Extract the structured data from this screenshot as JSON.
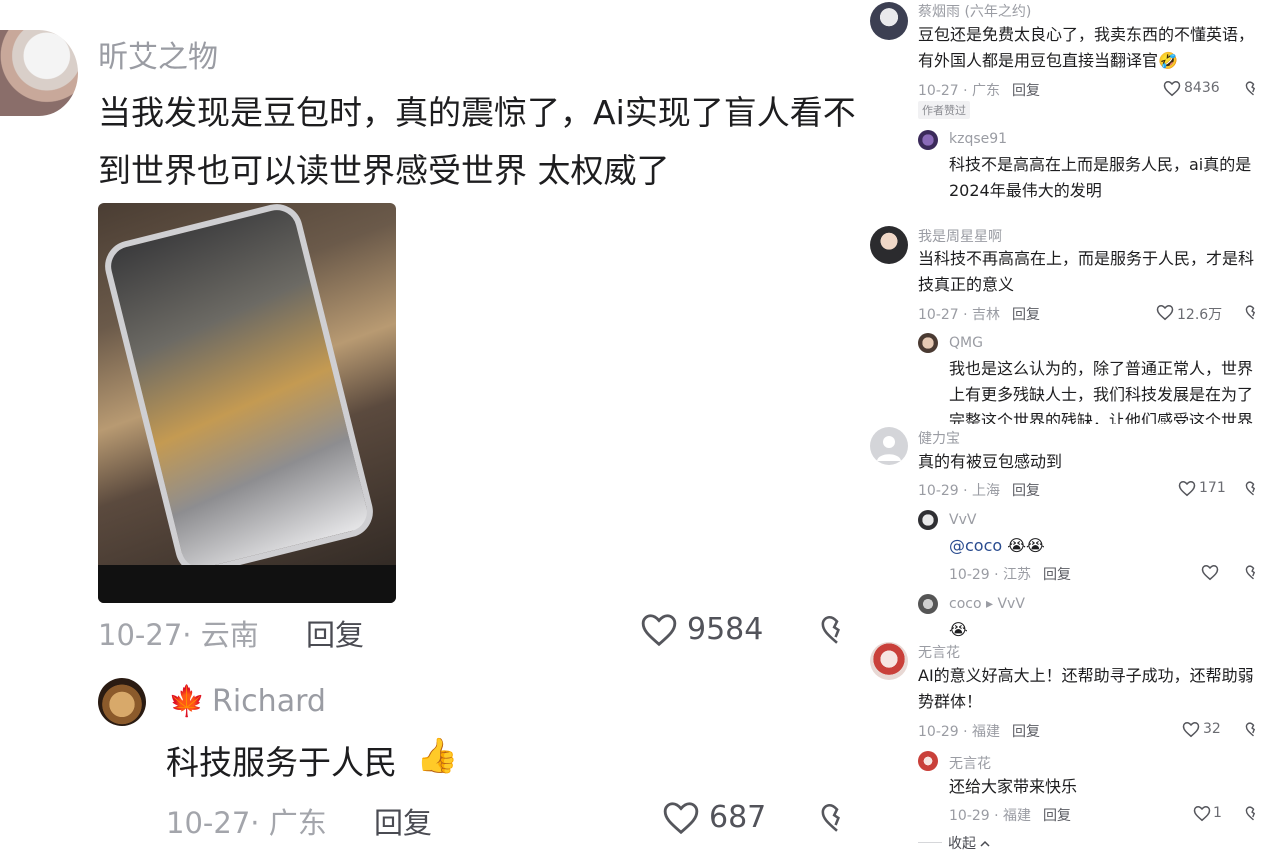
{
  "left": {
    "author": "昕艾之物",
    "text": "当我发现是豆包时，真的震惊了，Ai实现了盲人看不到世界也可以读世界感受世界  太权威了",
    "date_location": "10-27· 云南",
    "reply_label": "回复",
    "likes": "9584",
    "reply": {
      "flag": "🍁",
      "author": "Richard",
      "text": "科技服务于人民",
      "emoji": "👍",
      "date_location": "10-27· 广东",
      "reply_label": "回复",
      "likes": "687"
    }
  },
  "right": {
    "c1": {
      "author": "蔡烟雨 (六年之约)",
      "text": "豆包还是免费太良心了，我卖东西的不懂英语，有外国人都是用豆包直接当翻译官",
      "emoji": "🤣",
      "date_location": "10-27 · 广东",
      "reply_label": "回复",
      "likes": "8436",
      "badge": "作者赞过",
      "sub": {
        "author": "kzqse91",
        "text": "科技不是高高在上而是服务人民，ai真的是2024年最伟大的发明"
      }
    },
    "c2": {
      "author": "我是周星星啊",
      "text": "当科技不再高高在上，而是服务于人民，才是科技真正的意义",
      "date_location": "10-27 · 吉林",
      "reply_label": "回复",
      "likes": "12.6万",
      "sub": {
        "author": "QMG",
        "text": "我也是这么认为的，除了普通正常人，世界上有更多残缺人士，我们科技发展是在为了完整这个世界的残缺，让他们感受这个世界"
      }
    },
    "c3": {
      "author": "健力宝",
      "text": "真的有被豆包感动到",
      "date_location": "10-29 · 上海",
      "reply_label": "回复",
      "likes": "171",
      "sub1": {
        "author": "VvV",
        "mention": "@coco",
        "emoji": "😭😭",
        "date_location": "10-29 · 江苏",
        "reply_label": "回复"
      },
      "sub2": {
        "author": "coco",
        "arrow": "▸",
        "to": "VvV",
        "emoji": "😭"
      }
    },
    "c4": {
      "author": "无言花",
      "text": "AI的意义好高大上！还帮助寻子成功，还帮助弱势群体！",
      "date_location": "10-29 · 福建",
      "reply_label": "回复",
      "likes": "32",
      "sub": {
        "author": "无言花",
        "text": "还给大家带来快乐",
        "date_location": "10-29 · 福建",
        "reply_label": "回复",
        "likes": "1"
      }
    },
    "collapse_label": "收起",
    "collapse_icon": "chevron-up-icon"
  }
}
